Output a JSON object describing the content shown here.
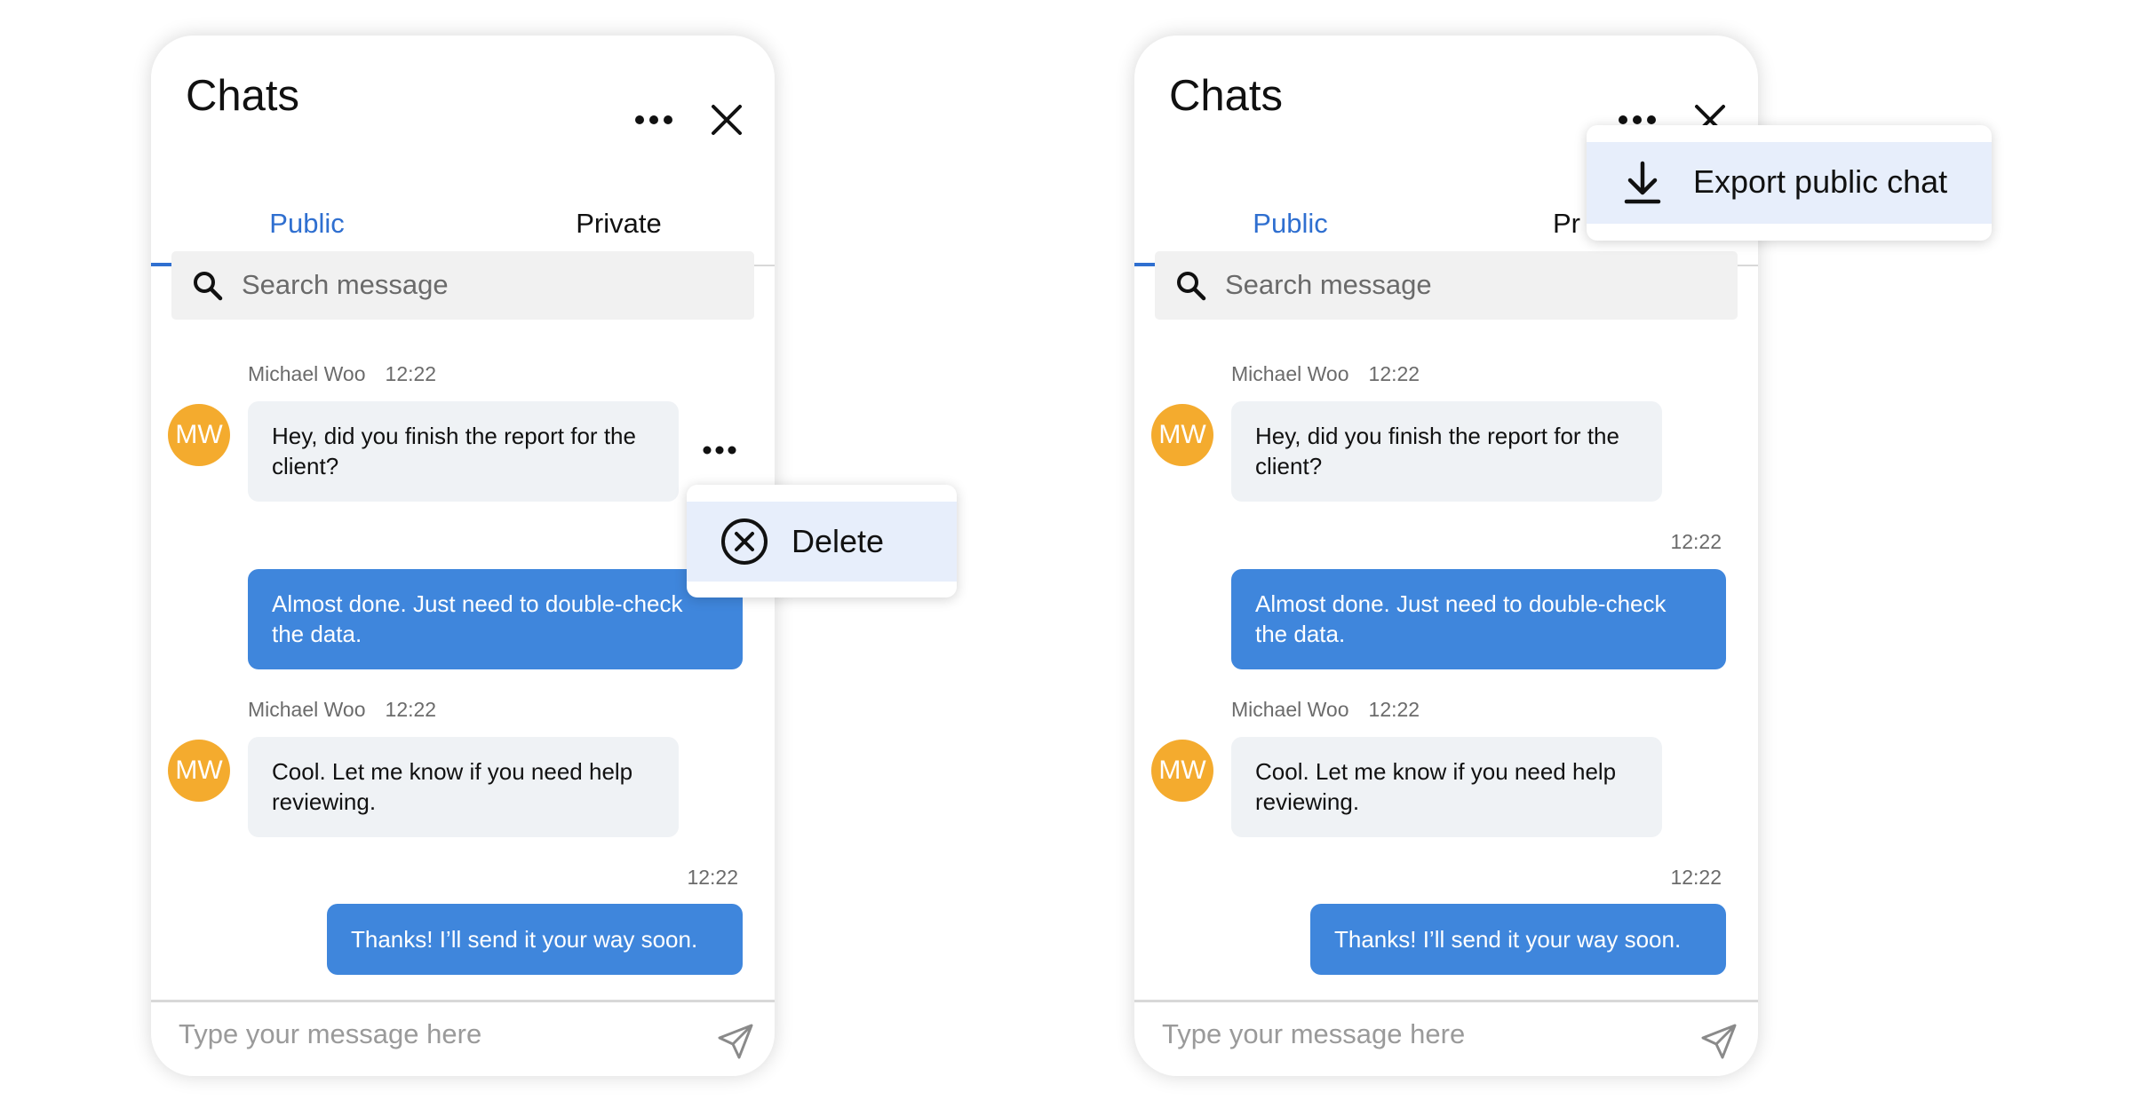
{
  "colors": {
    "accent": "#2f6fd0",
    "outgoing_bubble": "#3f86dc",
    "incoming_bubble": "#eff2f5",
    "avatar": "#f4ab2e",
    "menu_highlight": "#e7eefb"
  },
  "icons": [
    "more-horizontal-icon",
    "close-icon",
    "search-icon",
    "send-icon",
    "circle-x-icon",
    "download-icon"
  ],
  "panels": [
    {
      "title": "Chats",
      "tabs": [
        {
          "label": "Public",
          "active": true
        },
        {
          "label": "Private",
          "active": false
        }
      ],
      "search_placeholder": "Search message",
      "messages": [
        {
          "direction": "in",
          "author": "Michael Woo",
          "time": "12:22",
          "avatar": "MW",
          "text": "Hey, did you finish the report for the client?"
        },
        {
          "direction": "out",
          "time": "",
          "text": "Almost done. Just need to double-check the data."
        },
        {
          "direction": "in",
          "author": "Michael Woo",
          "time": "12:22",
          "avatar": "MW",
          "text": "Cool. Let me know if you need help reviewing."
        },
        {
          "direction": "out",
          "time": "12:22",
          "text": "Thanks! I’ll send it your way soon."
        }
      ],
      "composer_placeholder": "Type your message here",
      "context_menu": {
        "item": "Delete",
        "icon": "circle-x-icon"
      }
    },
    {
      "title": "Chats",
      "tabs": [
        {
          "label": "Public",
          "active": true
        },
        {
          "label": "Pr",
          "active": false
        }
      ],
      "search_placeholder": "Search message",
      "messages": [
        {
          "direction": "in",
          "author": "Michael Woo",
          "time": "12:22",
          "avatar": "MW",
          "text": "Hey, did you finish the report for the client?"
        },
        {
          "direction": "out",
          "time": "12:22",
          "text": "Almost done. Just need to double-check the data."
        },
        {
          "direction": "in",
          "author": "Michael Woo",
          "time": "12:22",
          "avatar": "MW",
          "text": "Cool. Let me know if you need help reviewing."
        },
        {
          "direction": "out",
          "time": "12:22",
          "text": "Thanks! I’ll send it your way soon."
        }
      ],
      "composer_placeholder": "Type your message here",
      "header_menu": {
        "item": "Export public chat",
        "icon": "download-icon"
      }
    }
  ]
}
